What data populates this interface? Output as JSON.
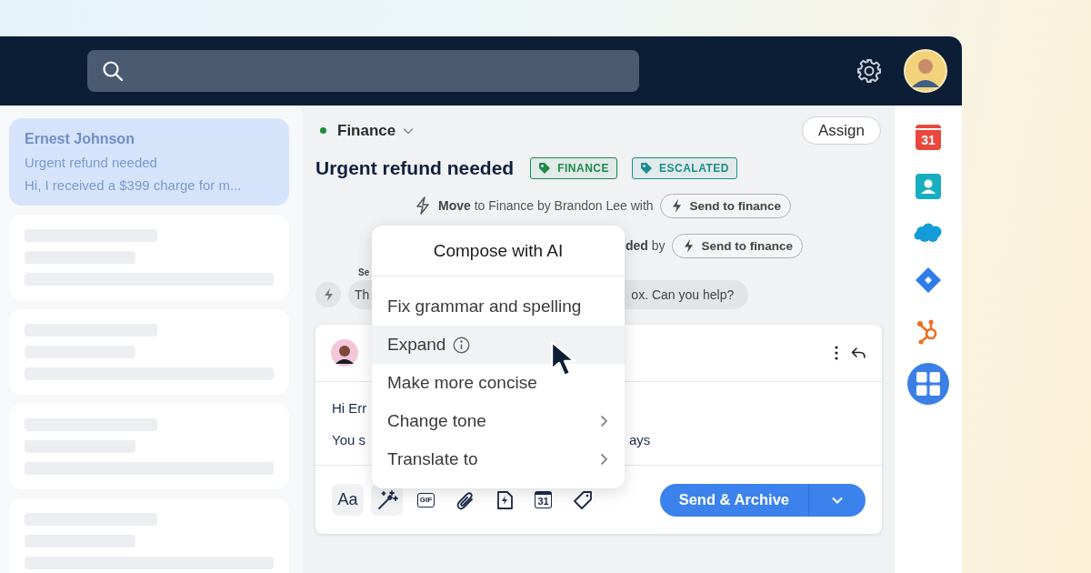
{
  "sidebar": {
    "conversations": [
      {
        "kind": "conversation",
        "selected": true,
        "name": "Ernest Johnson",
        "subject": "Urgent refund needed",
        "preview": "Hi, I received a $399 charge for m..."
      },
      {
        "kind": "skeleton",
        "selected": false
      },
      {
        "kind": "skeleton",
        "selected": false
      },
      {
        "kind": "skeleton",
        "selected": false
      },
      {
        "kind": "skeleton",
        "selected": false
      }
    ]
  },
  "conversation": {
    "inbox": "Finance",
    "assign_button": "Assign",
    "title": "Urgent refund needed",
    "tags": [
      {
        "label": "FINANCE",
        "color": "#1f8a4c"
      },
      {
        "label": "ESCALATED",
        "color": "#1b8c8c"
      }
    ],
    "activity": [
      {
        "text": "**Move** to Finance by Brandon Lee with",
        "button": "Send to finance"
      },
      {
        "text": "**ded** by",
        "button": "Send to finance"
      }
    ],
    "message": {
      "sender_label": "Se",
      "text_start": "Th",
      "text_end": "ox. Can you help?"
    }
  },
  "compose": {
    "body_lines": [
      {
        "start": "Hi Err"
      },
      {
        "start": "You s",
        "end": "ays"
      }
    ],
    "toolbar": [
      {
        "kind": "format",
        "label": "Aa",
        "active": true
      },
      {
        "kind": "ai",
        "active": true
      },
      {
        "kind": "gif",
        "label": "GIF",
        "active": false
      },
      {
        "kind": "attach",
        "active": false
      },
      {
        "kind": "snippet",
        "active": false
      },
      {
        "kind": "calendar",
        "label": "31",
        "active": false
      },
      {
        "kind": "tag",
        "active": false
      }
    ],
    "send_button": "Send & Archive"
  },
  "ai_menu": {
    "title": "Compose with AI",
    "items": [
      {
        "label": "Fix grammar and spelling",
        "info": false,
        "submenu": false,
        "selected": false
      },
      {
        "label": "Expand",
        "info": true,
        "submenu": false,
        "selected": true
      },
      {
        "label": "Make more concise",
        "info": false,
        "submenu": false,
        "selected": false
      },
      {
        "label": "Change tone",
        "info": false,
        "submenu": true,
        "selected": false
      },
      {
        "label": "Translate to",
        "info": false,
        "submenu": true,
        "selected": false
      }
    ]
  },
  "app_rail": [
    {
      "kind": "calendar",
      "label": "31"
    },
    {
      "kind": "contacts"
    },
    {
      "kind": "cloud"
    },
    {
      "kind": "diamond"
    },
    {
      "kind": "hub"
    },
    {
      "kind": "apps"
    }
  ]
}
